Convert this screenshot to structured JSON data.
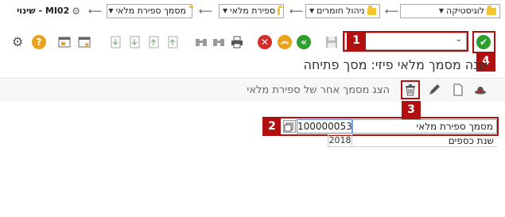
{
  "breadcrumb": [
    {
      "label": "לוגיסטיקה"
    },
    {
      "label": "ניהול חומרים"
    },
    {
      "label": "ספירת מלאי"
    },
    {
      "label": "מסמך ספירת מלאי"
    },
    {
      "label": "MI02 - שינוי"
    }
  ],
  "toolbar": {
    "command_value": ""
  },
  "badges": {
    "b1": "1",
    "b2": "2",
    "b3": "3",
    "b4": "4"
  },
  "title": "שנה מסמך מלאי פיזי: מסך פתיחה",
  "app_toolbar": {
    "other_doc_label": "הצג מסמך אחר של ספירת מלאי"
  },
  "form": {
    "doc_label": "מסמך ספירת מלאי",
    "doc_value": "100000053",
    "year_label": "שנת כספים",
    "year_value": "2018"
  },
  "colors": {
    "accent_red": "#b01010",
    "green": "#2e9e2e",
    "orange": "#e8a21c",
    "red_circle": "#d42b2b"
  }
}
